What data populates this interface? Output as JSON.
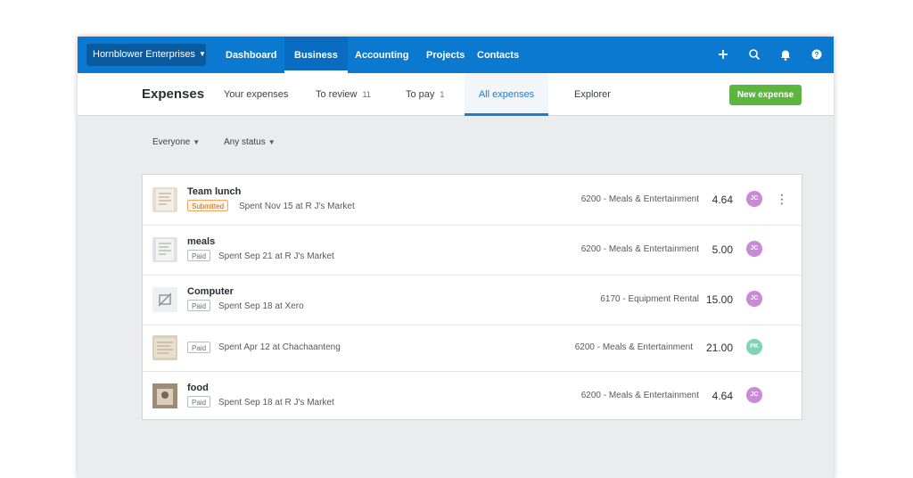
{
  "org": {
    "name": "Hornblower Enterprises"
  },
  "nav": {
    "items": [
      {
        "label": "Dashboard",
        "active": false
      },
      {
        "label": "Business",
        "active": true
      },
      {
        "label": "Accounting",
        "active": false
      },
      {
        "label": "Projects",
        "active": false
      },
      {
        "label": "Contacts",
        "active": false
      }
    ],
    "icons": [
      "plus-icon",
      "search-icon",
      "bell-icon",
      "help-icon"
    ]
  },
  "page": {
    "title": "Expenses"
  },
  "tabs": [
    {
      "label": "Your expenses",
      "count": ""
    },
    {
      "label": "To review",
      "count": "11"
    },
    {
      "label": "To pay",
      "count": "1"
    },
    {
      "label": "All expenses",
      "count": "",
      "active": true
    },
    {
      "label": "Explorer",
      "count": ""
    }
  ],
  "actions": {
    "new_expense": "New expense"
  },
  "filters": {
    "person": "Everyone",
    "status": "Any status"
  },
  "colors": {
    "nav": "#0b79d0",
    "accent": "#1c7cd5",
    "new_button": "#5bb53f",
    "avatar_jc": "#c98ad6",
    "avatar_pk": "#7fd4b4"
  },
  "expenses": [
    {
      "title": "Team lunch",
      "status": "Submitted",
      "spent": "Spent Nov 15 at R J's Market",
      "account": "6200 - Meals & Entertainment",
      "amount": "4.64",
      "user": "JC",
      "receipt": "receipt-thumbnail",
      "menu": true
    },
    {
      "title": "meals",
      "status": "Paid",
      "spent": "Spent Sep 21 at R J's Market",
      "account": "6200 - Meals & Entertainment",
      "amount": "5.00",
      "user": "JC",
      "receipt": "receipt-thumbnail"
    },
    {
      "title": "Computer",
      "status": "Paid",
      "spent": "Spent Sep 18 at Xero",
      "account": "6170 - Equipment Rental",
      "amount": "15.00",
      "user": "JC",
      "receipt": "no-image-icon"
    },
    {
      "title": "",
      "status": "Paid",
      "spent": "Spent Apr 12 at Chachaanteng",
      "account": "6200 - Meals & Entertainment",
      "amount": "21.00",
      "user": "PK",
      "receipt": "receipt-thumbnail"
    },
    {
      "title": "food",
      "status": "Paid",
      "spent": "Spent Sep 18 at R J's Market",
      "account": "6200 - Meals & Entertainment",
      "amount": "4.64",
      "user": "JC",
      "receipt": "photo-thumbnail"
    }
  ]
}
